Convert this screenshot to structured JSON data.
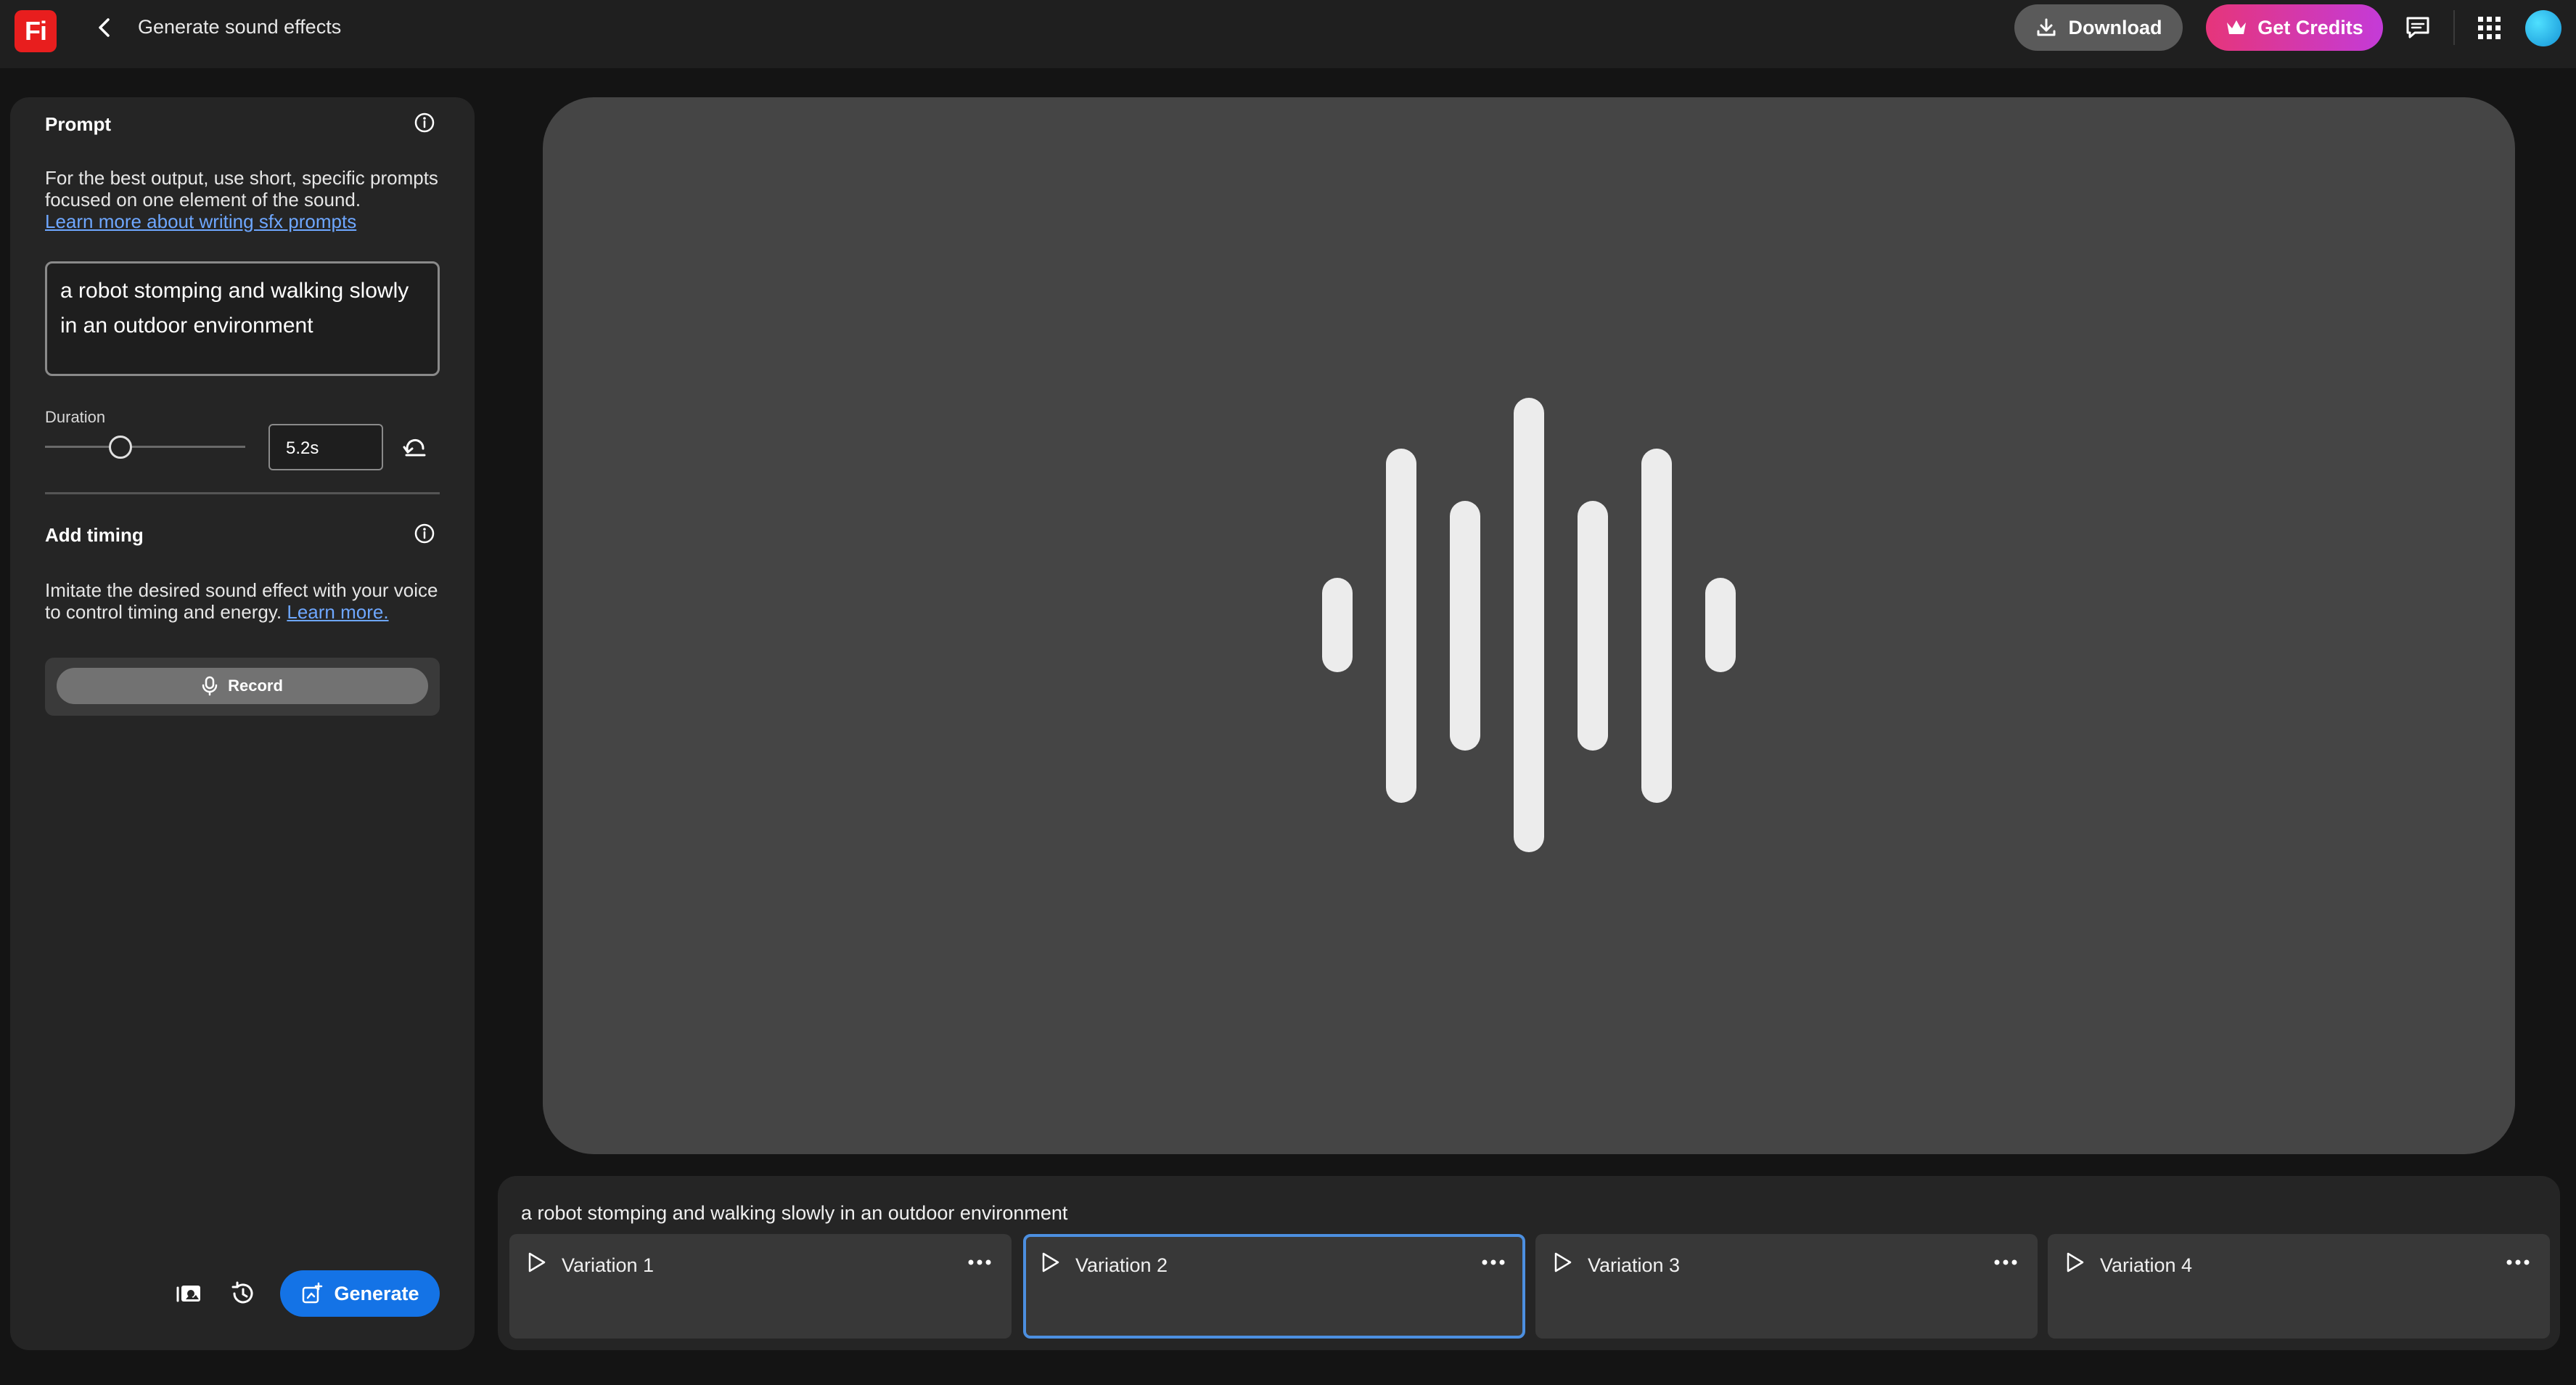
{
  "header": {
    "logo_text": "Fi",
    "title": "Generate sound effects",
    "download_label": "Download",
    "credits_label": "Get Credits"
  },
  "prompt_panel": {
    "title": "Prompt",
    "help_line1": "For the best output, use short, specific prompts",
    "help_line2": "focused on one element of the sound.",
    "learn_link": "Learn more about writing sfx prompts",
    "prompt_line1": "a robot stomping and walking slowly",
    "prompt_line2": "in an outdoor environment",
    "duration_label": "Duration",
    "duration_value": "5.2s",
    "duration_level": 0.3
  },
  "timing_panel": {
    "title": "Add timing",
    "help_line1": "Imitate the desired sound effect with your voice",
    "help_line2_prefix": "to control timing and energy. ",
    "learn_link": "Learn more.",
    "record_label": "Record"
  },
  "generate_label": "Generate",
  "results": {
    "prompt": "a robot stomping and walking slowly in an outdoor environment",
    "variations": [
      {
        "label": "Variation 1",
        "selected": false
      },
      {
        "label": "Variation 2",
        "selected": true
      },
      {
        "label": "Variation 3",
        "selected": false
      },
      {
        "label": "Variation 4",
        "selected": false
      }
    ]
  },
  "colors": {
    "accent": "#1473e6",
    "brand": "#e81e1e",
    "selected_border": "#4c8fe0"
  }
}
